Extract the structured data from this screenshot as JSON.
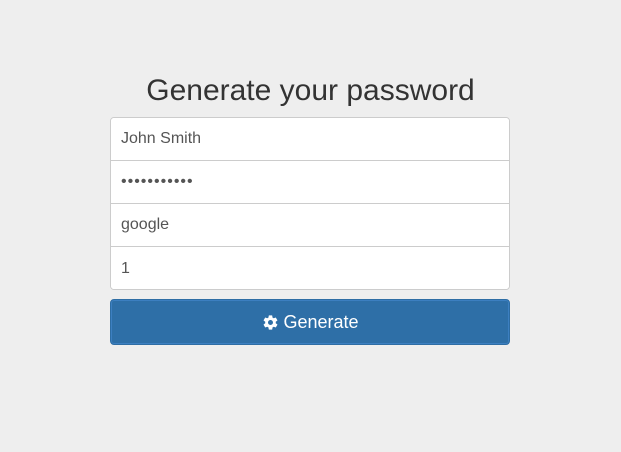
{
  "page": {
    "title": "Generate your password"
  },
  "form": {
    "name_value": "John Smith",
    "password_value": "•••••••••••",
    "site_value": "google",
    "counter_value": "1"
  },
  "actions": {
    "generate_label": "Generate",
    "generate_icon": "gear-icon"
  },
  "colors": {
    "background": "#eeeeee",
    "button": "#2e6fa7",
    "text": "#333333"
  }
}
